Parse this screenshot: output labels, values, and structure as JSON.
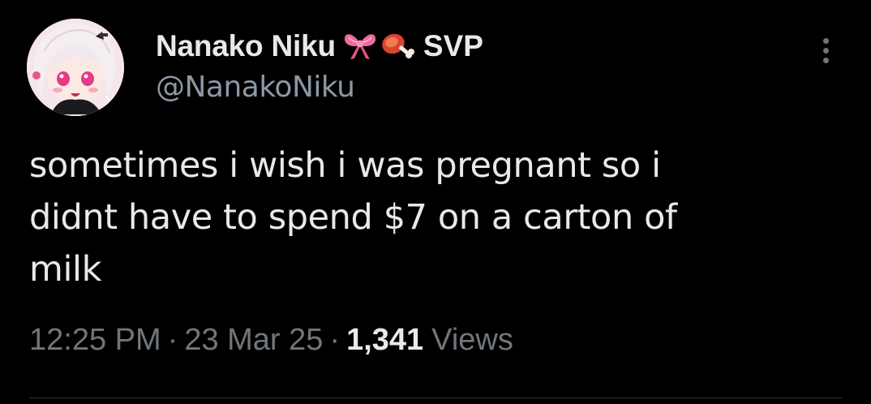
{
  "author": {
    "display_name": "Nanako Niku",
    "name_emojis": [
      "ribbon-emoji",
      "meat-on-bone-emoji"
    ],
    "name_suffix": "SVP",
    "handle": "@NanakoNiku"
  },
  "tweet": {
    "text": "sometimes i wish i was pregnant so i\ndidnt have to spend $7 on a carton of\nmilk",
    "time": "12:25 PM",
    "date": "23 Mar 25",
    "views_count": "1,341",
    "views_label": "Views",
    "separator": "·"
  },
  "icons": {
    "more": "more-vertical-icon"
  },
  "colors": {
    "background": "#000000",
    "primary_text": "#e7e9ea",
    "secondary_text": "#71767b",
    "ribbon": "#f06a9e",
    "meat": "#d9432f"
  }
}
